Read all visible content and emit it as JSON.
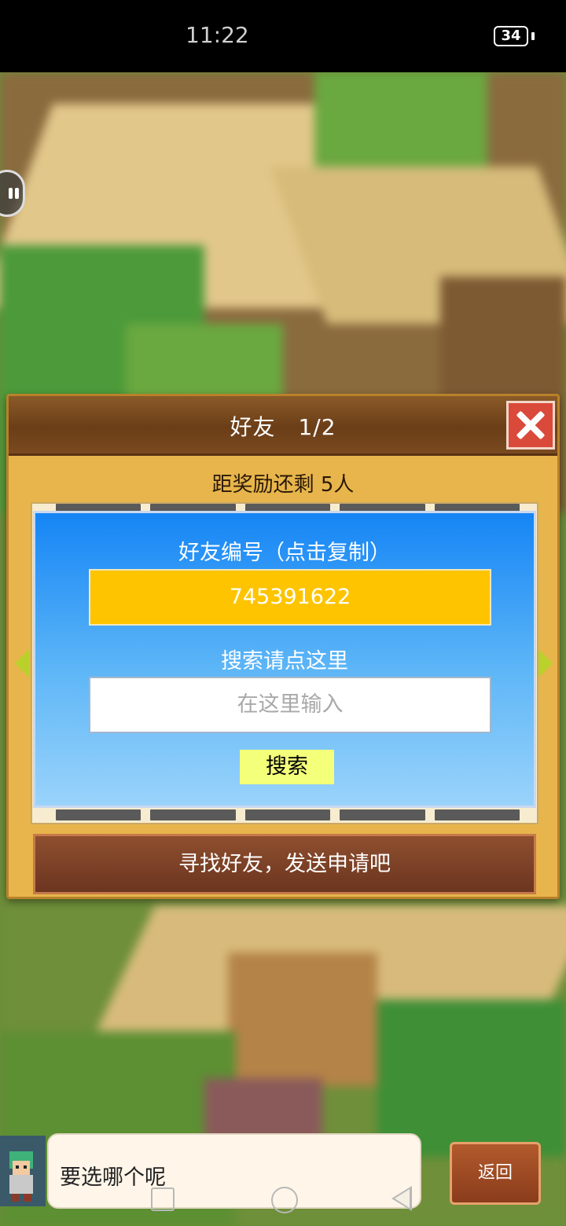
{
  "status_bar": {
    "time": "11:22",
    "battery": "34"
  },
  "dialog": {
    "title": "好友　1/2",
    "reward_text": "距奖励还剩 5人",
    "friend_code_label": "好友编号（点击复制）",
    "friend_code": "745391622",
    "search_label": "搜索请点这里",
    "search_placeholder": "在这里输入",
    "search_button": "搜索",
    "find_friends_button": "寻找好友，发送申请吧"
  },
  "bottom": {
    "speech_text": "要选哪个呢",
    "back_button": "返回"
  },
  "icons": [
    "close-icon",
    "pause-icon",
    "arrow-left-icon",
    "arrow-right-icon",
    "nav-square-icon",
    "nav-home-icon",
    "nav-back-icon"
  ],
  "colors": {
    "header_brown": "#6b3e18",
    "code_box": "#ffc400",
    "panel_blue": "#1585f5",
    "search_button": "#f4ff7a",
    "find_button": "#7a3f24",
    "close_red": "#d94a3a"
  }
}
